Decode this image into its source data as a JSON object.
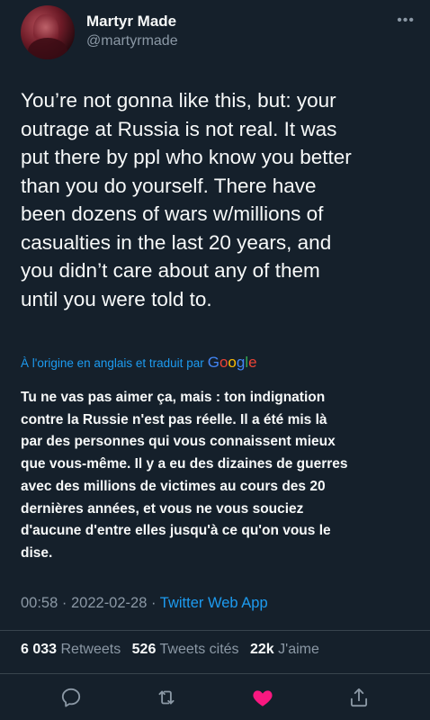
{
  "author": {
    "display_name": "Martyr Made",
    "handle": "@martyrmade"
  },
  "more_icon": "•••",
  "tweet": {
    "text": "You’re not gonna like this, but: your\noutrage at Russia is not real. It was\nput there by ppl who know you better\nthan you do yourself. There have\nbeen dozens of wars w/millions of\ncasualties in the last 20 years, and\nyou didn’t care about any of them\nuntil you were told to."
  },
  "translation": {
    "label": "À l'origine en anglais et traduit par",
    "provider": "Google",
    "text": "Tu ne vas pas aimer ça, mais : ton indignation\ncontre la Russie n'est pas réelle. Il a été mis là\npar des personnes qui vous connaissent mieux\nque vous-même. Il y a eu des dizaines de guerres\navec des millions de victimes au cours des 20\ndernières années, et vous ne vous souciez\nd'aucune d'entre elles jusqu'à ce qu'on vous le\ndise."
  },
  "meta": {
    "time": "00:58",
    "separator": "·",
    "date": "2022-02-28",
    "source": "Twitter Web App"
  },
  "stats": {
    "retweets_count": "6 033",
    "retweets_label": "Retweets",
    "quotes_count": "526",
    "quotes_label": "Tweets cités",
    "likes_count": "22k",
    "likes_label": "J'aime"
  },
  "actions": [
    "reply-icon",
    "retweet-icon",
    "like-icon",
    "share-icon"
  ],
  "colors": {
    "background": "#15202b",
    "text": "#f7f9f9",
    "secondary": "#8b98a5",
    "accent": "#1d9bf0",
    "like": "#f91880",
    "divider": "#38444d"
  }
}
